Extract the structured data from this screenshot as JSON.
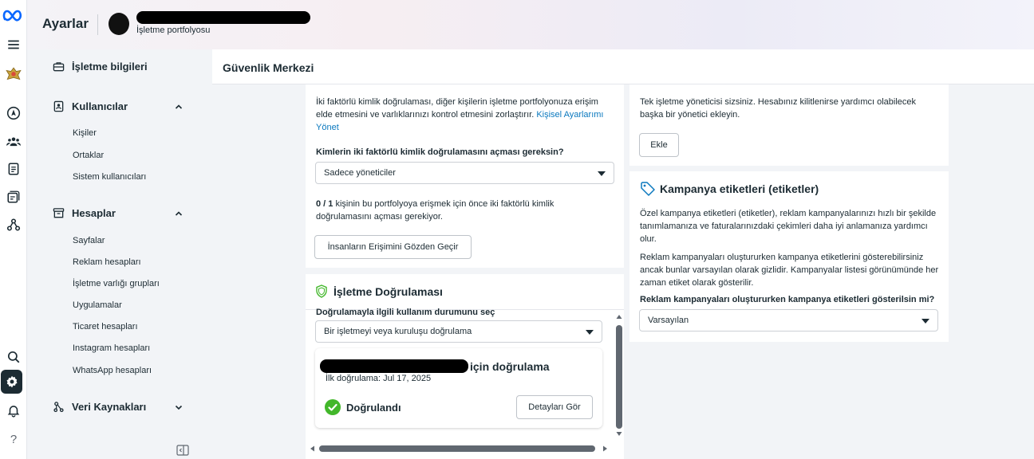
{
  "app": {
    "title": "Ayarlar",
    "portfolio_subtitle": "İşletme portfolyosu"
  },
  "rail": {
    "icons": [
      "meta-logo",
      "menu-icon",
      "business-logo",
      "compass-icon",
      "people-icon",
      "document-icon",
      "billing-icon",
      "integrations-icon",
      "search-icon",
      "gear-icon",
      "bell-icon",
      "help-icon"
    ]
  },
  "sidebar": {
    "business_info": "İşletme bilgileri",
    "users": {
      "label": "Kullanıcılar",
      "items": [
        "Kişiler",
        "Ortaklar",
        "Sistem kullanıcıları"
      ]
    },
    "accounts": {
      "label": "Hesaplar",
      "items": [
        "Sayfalar",
        "Reklam hesapları",
        "İşletme varlığı grupları",
        "Uygulamalar",
        "Ticaret hesapları",
        "Instagram hesapları",
        "WhatsApp hesapları"
      ]
    },
    "data_sources": {
      "label": "Veri Kaynakları"
    }
  },
  "main": {
    "title": "Güvenlik Merkezi"
  },
  "two_factor": {
    "desc": "İki faktörlü kimlik doğrulaması, diğer kişilerin işletme portfolyonuza erişim elde etmesini ve varlıklarınızı kontrol etmesini zorlaştırır.",
    "link": "Kişisel Ayarlarımı Yönet",
    "question": "Kimlerin iki faktörlü kimlik doğrulamasını açması gereksin?",
    "select_value": "Sadece yöneticiler",
    "count": "0 / 1",
    "count_desc": "kişinin bu portfolyoya erişmek için önce iki faktörlü kimlik doğrulamasını açması gerekiyor.",
    "review_button": "İnsanların Erişimini Gözden Geçir"
  },
  "verification": {
    "title": "İşletme Doğrulaması",
    "usage_label": "Doğrulamayla ilgili kullanım durumunu seç",
    "select_value": "Bir işletmeyi veya kuruluşu doğrulama",
    "name_suffix": "için doğrulama",
    "first_verified": "İlk doğrulama: Jul 17, 2025",
    "status": "Doğrulandı",
    "details_button": "Detayları Gör"
  },
  "admin": {
    "desc": "Tek işletme yöneticisi sizsiniz. Hesabınız kilitlenirse yardımcı olabilecek başka bir yönetici ekleyin.",
    "add_button": "Ekle"
  },
  "tags": {
    "title": "Kampanya etiketleri (etiketler)",
    "desc1": "Özel kampanya etiketleri (etiketler), reklam kampanyalarınızı hızlı bir şekilde tanımlamanıza ve faturalarınızdaki çekimleri daha iyi anlamanıza yardımcı olur.",
    "desc2": "Reklam kampanyaları oluştururken kampanya etiketlerini gösterebilirsiniz ancak bunlar varsayılan olarak gizlidir. Kampanyalar listesi görünümünde her zaman etiket olarak gösterilir.",
    "question": "Reklam kampanyaları oluştururken kampanya etiketleri gösterilsin mi?",
    "select_value": "Varsayılan"
  },
  "colors": {
    "accent": "#0a78be",
    "success": "#42b72a",
    "text": "#1c2b33"
  }
}
